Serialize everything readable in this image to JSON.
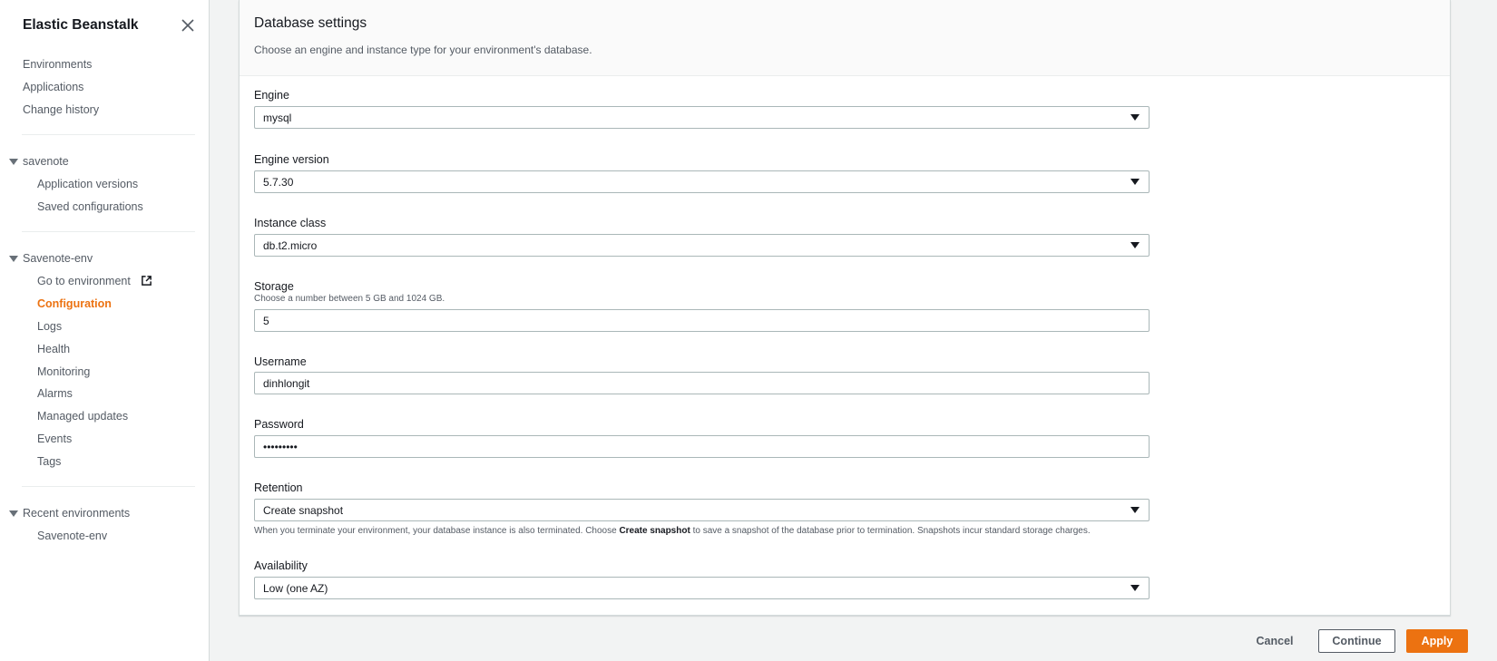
{
  "sidebar": {
    "title": "Elastic Beanstalk",
    "top_links": [
      "Environments",
      "Applications",
      "Change history"
    ],
    "app_section": {
      "name": "savenote",
      "links": [
        "Application versions",
        "Saved configurations"
      ]
    },
    "env_section": {
      "name": "Savenote-env",
      "links": [
        "Go to environment",
        "Configuration",
        "Logs",
        "Health",
        "Monitoring",
        "Alarms",
        "Managed updates",
        "Events",
        "Tags"
      ],
      "active": "Configuration"
    },
    "recent_section": {
      "name": "Recent environments",
      "links": [
        "Savenote-env"
      ]
    }
  },
  "panel": {
    "title": "Database settings",
    "description": "Choose an engine and instance type for your environment's database."
  },
  "fields": {
    "engine": {
      "label": "Engine",
      "value": "mysql"
    },
    "engine_version": {
      "label": "Engine version",
      "value": "5.7.30"
    },
    "instance_class": {
      "label": "Instance class",
      "value": "db.t2.micro"
    },
    "storage": {
      "label": "Storage",
      "hint": "Choose a number between 5 GB and 1024 GB.",
      "value": "5"
    },
    "username": {
      "label": "Username",
      "value": "dinhlongit"
    },
    "password": {
      "label": "Password",
      "value": "•••••••••"
    },
    "retention": {
      "label": "Retention",
      "value": "Create snapshot",
      "hint_before": "When you terminate your environment, your database instance is also terminated. Choose ",
      "hint_bold": "Create snapshot",
      "hint_after": " to save a snapshot of the database prior to termination. Snapshots incur standard storage charges."
    },
    "availability": {
      "label": "Availability",
      "value": "Low (one AZ)"
    }
  },
  "footer": {
    "cancel_label": "Cancel",
    "continue_label": "Continue",
    "apply_label": "Apply"
  },
  "colors": {
    "accent": "#ec7211",
    "text": "#16191f",
    "muted": "#545b64",
    "border": "#aab7b8"
  }
}
